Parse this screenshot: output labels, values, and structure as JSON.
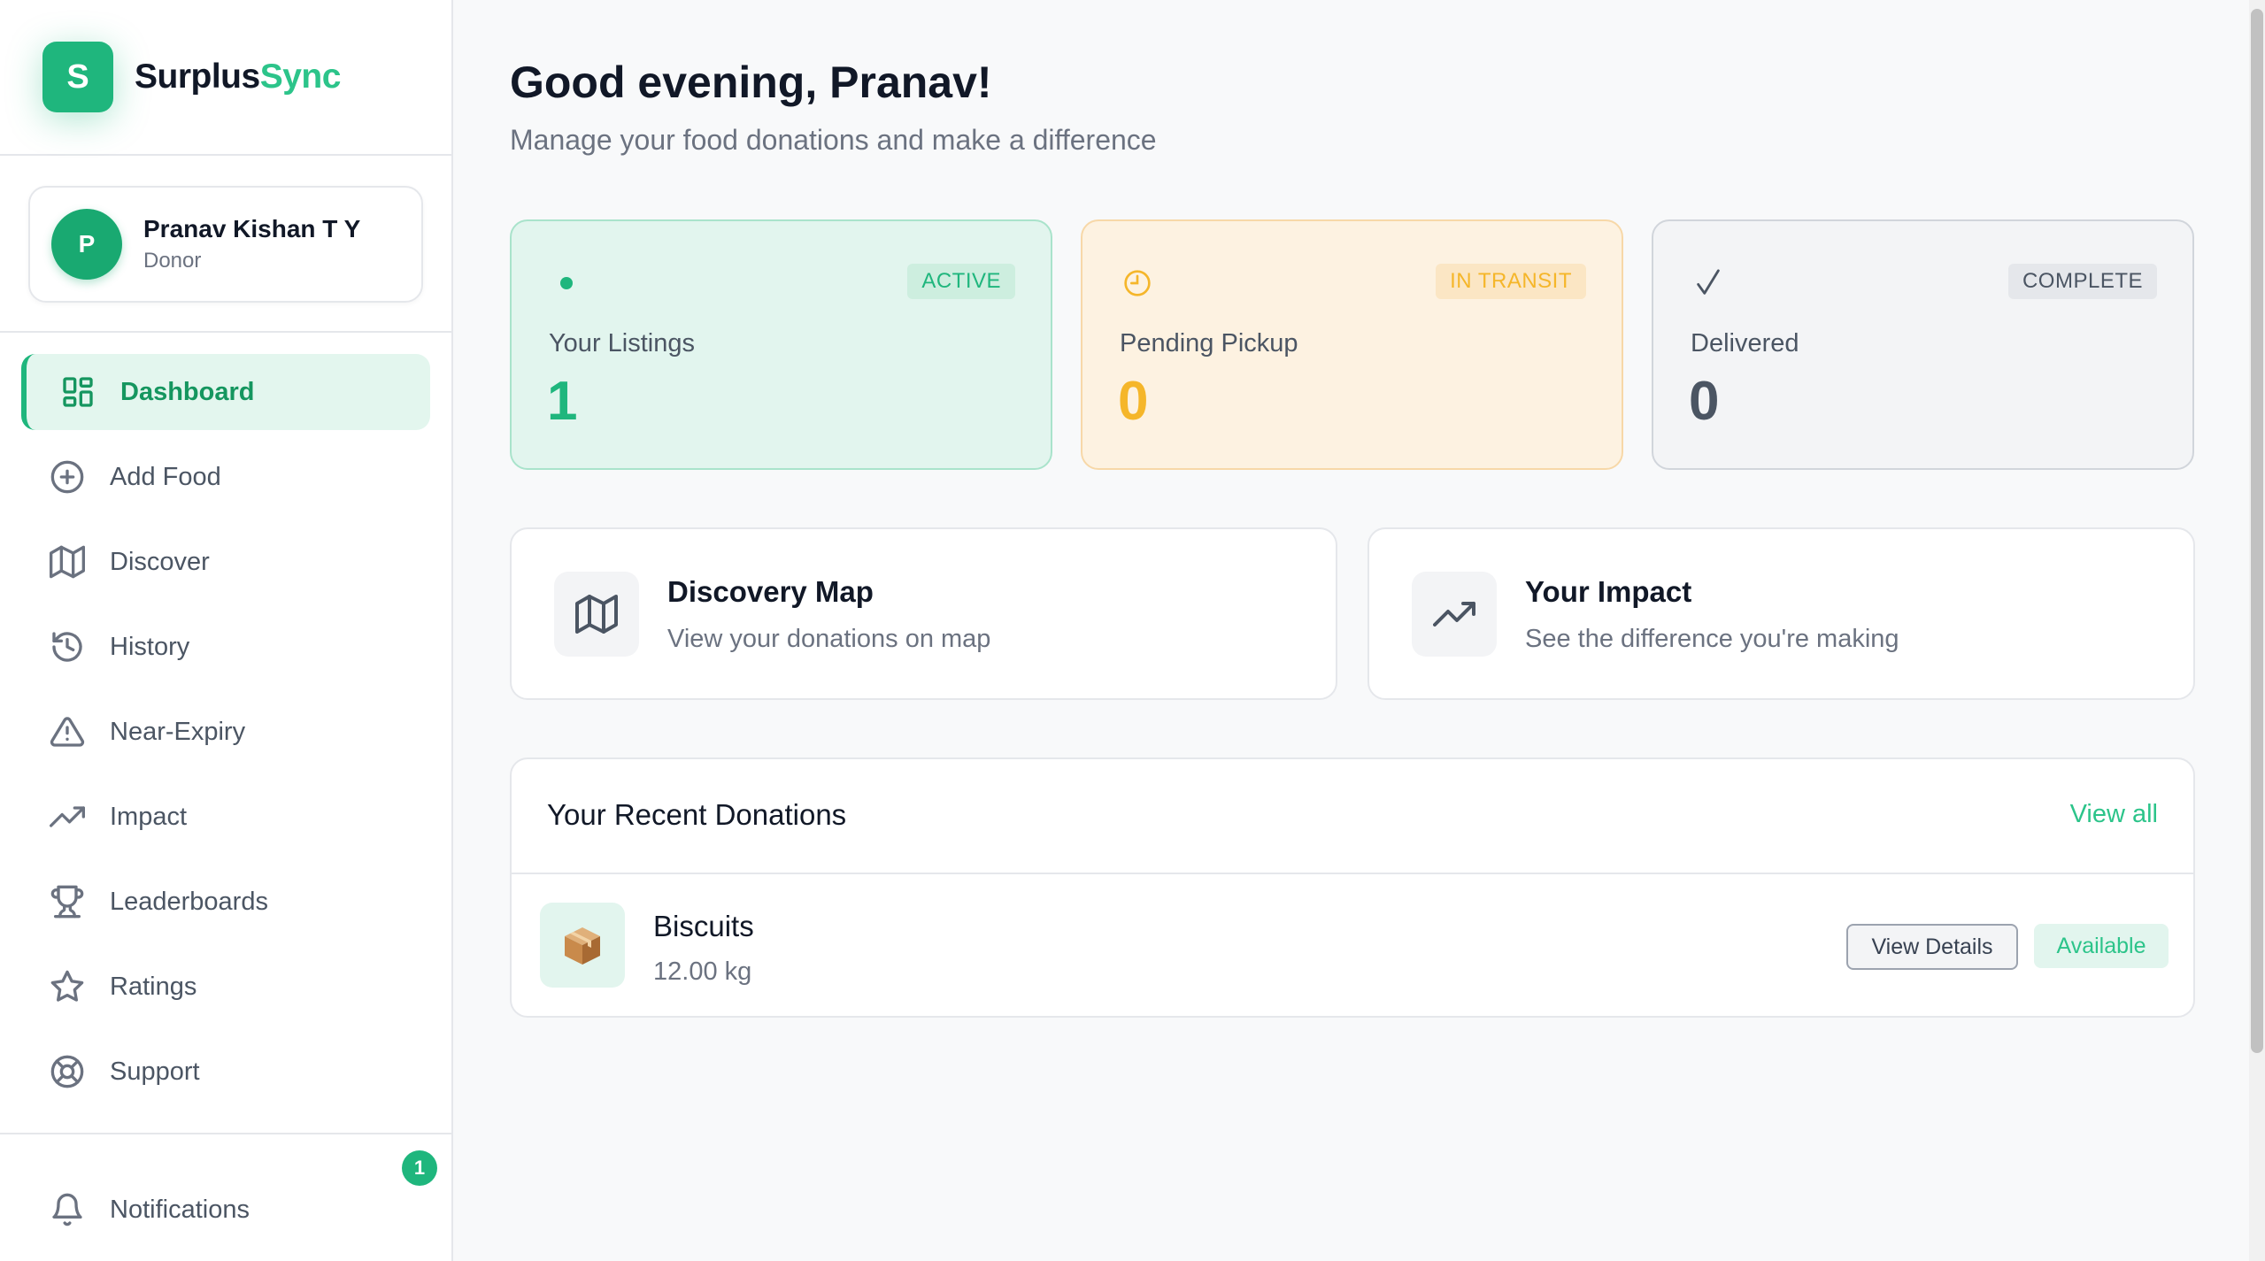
{
  "brand": {
    "logo_letter": "S",
    "name_part1": "Surplus",
    "name_part2": "Sync",
    "accent_color": "#1fb67d"
  },
  "user": {
    "avatar_letter": "P",
    "name": "Pranav Kishan T Y",
    "role": "Donor"
  },
  "nav": [
    {
      "label": "Dashboard",
      "icon": "dashboard-icon",
      "active": true
    },
    {
      "label": "Add Food",
      "icon": "plus-circle-icon"
    },
    {
      "label": "Discover",
      "icon": "map-icon"
    },
    {
      "label": "History",
      "icon": "history-icon"
    },
    {
      "label": "Near-Expiry",
      "icon": "warning-triangle-icon"
    },
    {
      "label": "Impact",
      "icon": "trending-up-icon"
    },
    {
      "label": "Leaderboards",
      "icon": "trophy-icon"
    },
    {
      "label": "Ratings",
      "icon": "star-icon"
    },
    {
      "label": "Support",
      "icon": "lifebuoy-icon"
    }
  ],
  "notifications": {
    "label": "Notifications",
    "icon": "bell-icon",
    "count": "1"
  },
  "header": {
    "greeting": "Good evening, Pranav!",
    "subtitle": "Manage your food donations and make a difference"
  },
  "stats": [
    {
      "icon": "dot-icon",
      "badge": "ACTIVE",
      "label": "Your Listings",
      "value": "1",
      "color": "#1fb67d"
    },
    {
      "icon": "clock-icon",
      "badge": "IN TRANSIT",
      "label": "Pending Pickup",
      "value": "0",
      "color": "#f5b62a"
    },
    {
      "icon": "check-icon",
      "badge": "COMPLETE",
      "label": "Delivered",
      "value": "0",
      "color": "#4b5563"
    }
  ],
  "features": [
    {
      "icon": "map-icon",
      "title": "Discovery Map",
      "desc": "View your donations on map"
    },
    {
      "icon": "trending-up-icon",
      "title": "Your Impact",
      "desc": "See the difference you're making"
    }
  ],
  "recent": {
    "title": "Your Recent Donations",
    "view_all": "View all",
    "items": [
      {
        "icon": "package-icon",
        "name": "Biscuits",
        "quantity": "12.00 kg",
        "details_label": "View Details",
        "status": "Available"
      }
    ]
  }
}
